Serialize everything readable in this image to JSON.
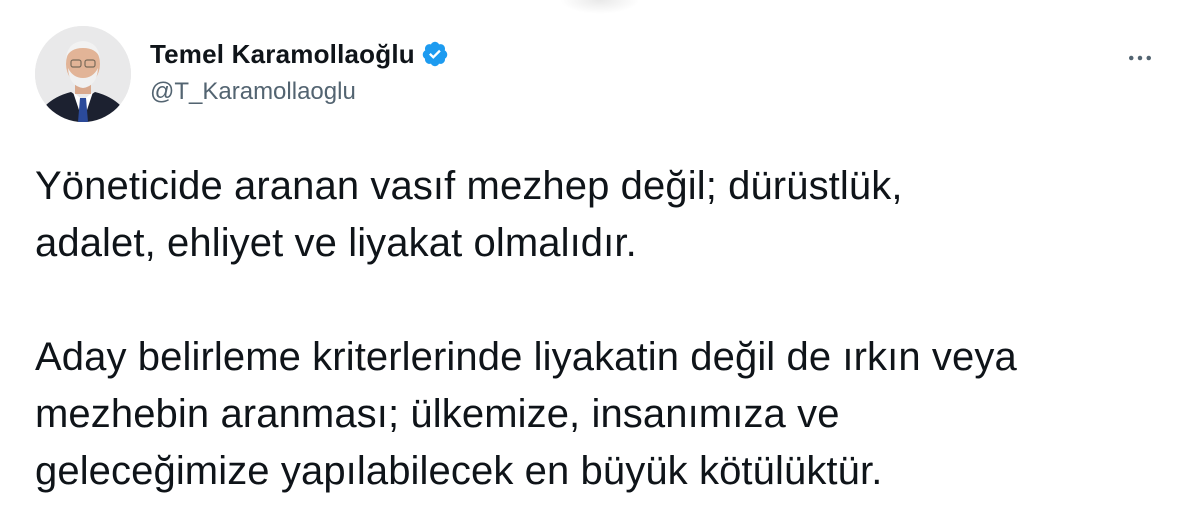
{
  "author": {
    "display_name": "Temel Karamollaoğlu",
    "handle": "@T_Karamollaoglu",
    "verified": true,
    "verified_color": "#1d9bf0"
  },
  "tweet": {
    "text": "Yöneticide aranan vasıf mezhep değil; dürüstlük,\nadalet, ehliyet ve liyakat olmalıdır.\n\nAday belirleme kriterlerinde liyakatin değil de ırkın veya\nmezhebin aranması; ülkemize, insanımıza ve\ngeleceğimize yapılabilecek en büyük kötülüktür."
  },
  "icons": {
    "verified": "verified-badge-icon",
    "more": "more-options-icon"
  },
  "colors": {
    "text_primary": "#0f1419",
    "text_secondary": "#536471",
    "background": "#ffffff"
  }
}
